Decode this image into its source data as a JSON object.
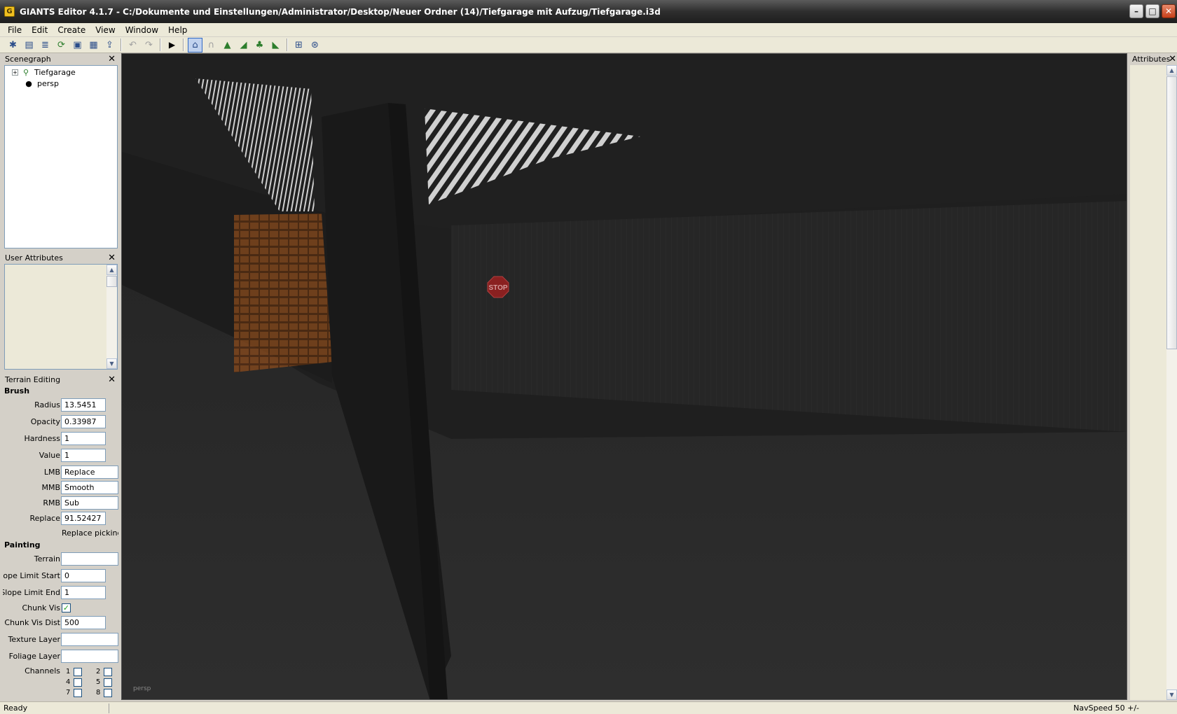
{
  "window": {
    "title": "GIANTS Editor 4.1.7 - C:/Dokumente und Einstellungen/Administrator/Desktop/Neuer Ordner (14)/Tiefgarage mit Aufzug/Tiefgarage.i3d",
    "minimize": "–",
    "maximize": "□",
    "close": "✕"
  },
  "menu": {
    "items": [
      "File",
      "Edit",
      "Create",
      "View",
      "Window",
      "Help"
    ]
  },
  "toolbar": {
    "icons": [
      "new-icon",
      "open-icon",
      "list-icon",
      "reload-icon",
      "save-icon",
      "save-all-icon",
      "export-icon",
      "undo-icon",
      "redo-icon",
      "play-icon",
      "home-icon",
      "magnet-icon",
      "terrain-raise-icon",
      "terrain-paint-icon",
      "foliage-icon",
      "terrain-smooth-icon",
      "grid-icon",
      "grid-settings-icon"
    ]
  },
  "scenegraph": {
    "title": "Scenegraph",
    "close": "✕",
    "nodes": [
      {
        "label": "Tiefgarage",
        "expander": "+"
      },
      {
        "label": "persp"
      }
    ]
  },
  "user_attributes": {
    "title": "User Attributes",
    "close": "✕"
  },
  "terrain_editing": {
    "title": "Terrain Editing",
    "close": "✕",
    "brush_title": "Brush",
    "radius_label": "Radius",
    "radius_value": "13.5451",
    "opacity_label": "Opacity",
    "opacity_value": "0.33987",
    "hardness_label": "Hardness",
    "hardness_value": "1",
    "value_label": "Value",
    "value_value": "1",
    "lmb_label": "LMB",
    "lmb_value": "Replace",
    "mmb_label": "MMB",
    "mmb_value": "Smooth",
    "rmb_label": "RMB",
    "rmb_value": "Sub",
    "replace_label": "Replace",
    "replace_value": "91.52427",
    "replace_picking": "Replace picking: c",
    "painting_title": "Painting",
    "terrain_label": "Terrain",
    "terrain_value": "",
    "slope_start_label": "Slope Limit Start",
    "slope_start_value": "0",
    "slope_end_label": "Slope Limit End",
    "slope_end_value": "1",
    "chunk_vis_label": "Chunk Vis",
    "chunk_vis_checked": "✓",
    "chunk_vis_dist_label": "Chunk Vis Dist",
    "chunk_vis_dist_value": "500",
    "texture_layer_label": "Texture Layer",
    "texture_layer_value": "",
    "foliage_layer_label": "Foliage Layer",
    "foliage_layer_value": "",
    "channels_label": "Channels",
    "channels": [
      "1",
      "2",
      "4",
      "5",
      "7",
      "8"
    ]
  },
  "viewport": {
    "camera_label": "persp",
    "stop_sign_text": "STOP"
  },
  "attributes_panel": {
    "title": "Attributes",
    "close": "✕"
  },
  "statusbar": {
    "left": "Ready",
    "right": "NavSpeed 50 +/-"
  },
  "colors": {
    "viewport_bg": "#212121",
    "title_bar": "#2e2e2e",
    "panel_bg": "#ece9d8",
    "selection": "#316ac5",
    "stop_sign": "#8a2020"
  }
}
